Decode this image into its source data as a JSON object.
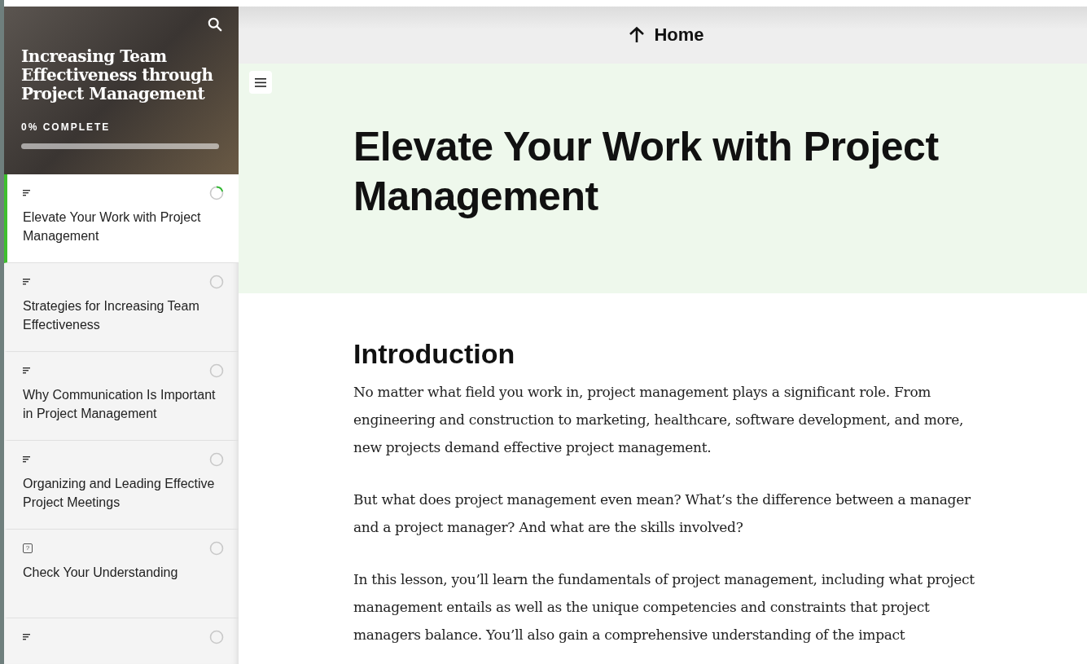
{
  "sidebar": {
    "course_title": "Increasing Team Effectiveness through Project Management",
    "progress_label": "0% COMPLETE",
    "progress": {
      "level": 0
    },
    "lessons": [
      {
        "kind": "text",
        "title": "Elevate Your Work with Project Management",
        "selected": true,
        "started": true
      },
      {
        "kind": "text",
        "title": "Strategies for Increasing Team Effectiveness",
        "selected": false,
        "started": false
      },
      {
        "kind": "text",
        "title": "Why Communication Is Important in Project Management",
        "selected": false,
        "started": false
      },
      {
        "kind": "text",
        "title": "Organizing and Leading Effective Project Meetings",
        "selected": false,
        "started": false
      },
      {
        "kind": "quiz",
        "icon": "?",
        "title": "Check Your Understanding",
        "selected": false,
        "started": false
      },
      {
        "kind": "text",
        "selected": false,
        "started": false
      }
    ]
  },
  "top_bar": {
    "home_link": "Home"
  },
  "lesson": {
    "title": "Elevate Your Work with Project Management",
    "section_heading": "Introduction",
    "paragraphs": [
      "No matter what field you work in, project management plays a significant role. From engineering and construction to marketing, healthcare, software development, and more, new projects demand effective project management.",
      "But what does project management even mean? What’s the difference between a manager and a project manager? And what are the skills involved?",
      "In this lesson, you’ll learn the fundamentals of project management, including what project management entails as well as the unique competencies and constraints that project managers balance. You’ll also gain a comprehensive understanding of the impact"
    ]
  }
}
